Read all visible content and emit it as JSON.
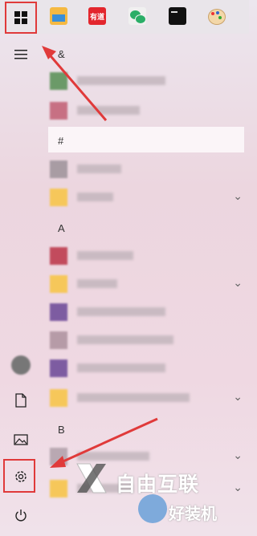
{
  "taskbar": {
    "apps": [
      {
        "name": "file-explorer-icon",
        "color": "#f5b942"
      },
      {
        "name": "youdao-icon",
        "color": "#e3262d",
        "label": "有道"
      },
      {
        "name": "wechat-icon",
        "color": "#2aae67"
      },
      {
        "name": "terminal-icon",
        "color": "#111111"
      },
      {
        "name": "paint-icon",
        "color": "#ffd24a"
      }
    ]
  },
  "sidebar": {
    "menu_icon": "hamburger-icon",
    "items": [
      {
        "name": "avatar"
      },
      {
        "name": "documents-icon"
      },
      {
        "name": "pictures-icon"
      },
      {
        "name": "settings-icon"
      },
      {
        "name": "power-icon"
      }
    ]
  },
  "app_list": {
    "section_amp": "&",
    "section_hash": "#",
    "section_a": "A",
    "section_b": "B",
    "chevron": "⌄",
    "rows": [
      {
        "thumb": "#6b9a68",
        "label_width": 110,
        "expandable": false
      },
      {
        "thumb": "#c77083",
        "label_width": 78,
        "expandable": false
      },
      {
        "thumb": "#a89ca3",
        "label_width": 55,
        "expandable": false
      },
      {
        "thumb": "#f6c75a",
        "label_width": 45,
        "expandable": true
      },
      {
        "thumb": "#c24b5d",
        "label_width": 70,
        "expandable": false
      },
      {
        "thumb": "#f6c75a",
        "label_width": 50,
        "expandable": true
      },
      {
        "thumb": "#7d5ca1",
        "label_width": 110,
        "expandable": false
      },
      {
        "thumb": "#b69ba7",
        "label_width": 120,
        "expandable": false
      },
      {
        "thumb": "#7d5ca1",
        "label_width": 110,
        "expandable": false
      },
      {
        "thumb": "#f6c75a",
        "label_width": 140,
        "expandable": true
      },
      {
        "thumb": "#b9a8b2",
        "label_width": 90,
        "expandable": false
      },
      {
        "thumb": "#f6c75a",
        "label_width": 70,
        "expandable": true
      }
    ]
  },
  "watermark": {
    "brand": "自由互联",
    "sub": "好装机"
  },
  "colors": {
    "annotation": "#e03a3a"
  }
}
